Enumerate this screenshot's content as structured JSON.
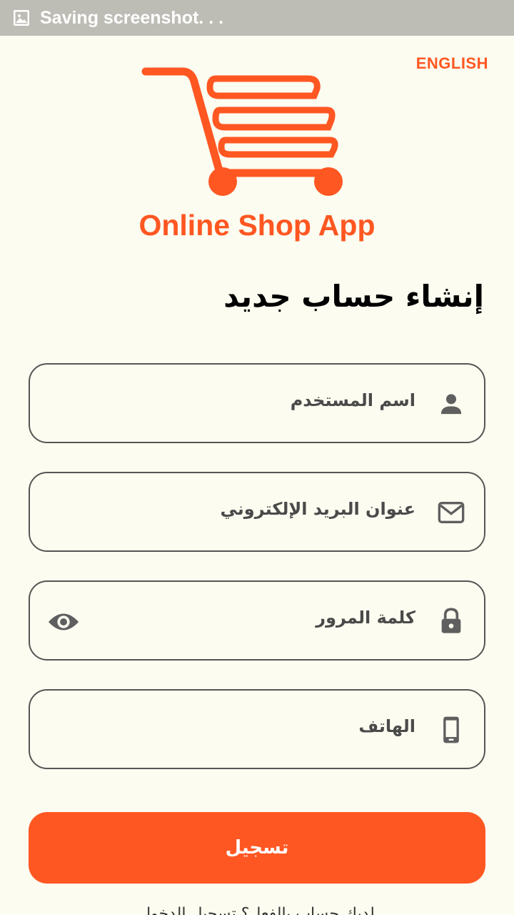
{
  "status_bar": {
    "text": "Saving screenshot. . ."
  },
  "language_link": "ENGLISH",
  "app_title": "Online Shop App",
  "page_title": "إنشاء حساب جديد",
  "fields": {
    "username": {
      "label": "اسم المستخدم",
      "icon": "person-icon"
    },
    "email": {
      "label": "عنوان البريد الإلكتروني",
      "icon": "mail-icon"
    },
    "password": {
      "label": "كلمة المرور",
      "icon": "lock-icon",
      "toggle_icon": "eye-icon"
    },
    "phone": {
      "label": "الهاتف",
      "icon": "phone-icon"
    }
  },
  "register_button": "تسجيل",
  "bottom_hint": "لديك حساب بالفعل؟ تسجيل الدخول",
  "colors": {
    "accent": "#ff5722",
    "background": "#fcfcf0",
    "statusbar": "#bdbcb5"
  }
}
